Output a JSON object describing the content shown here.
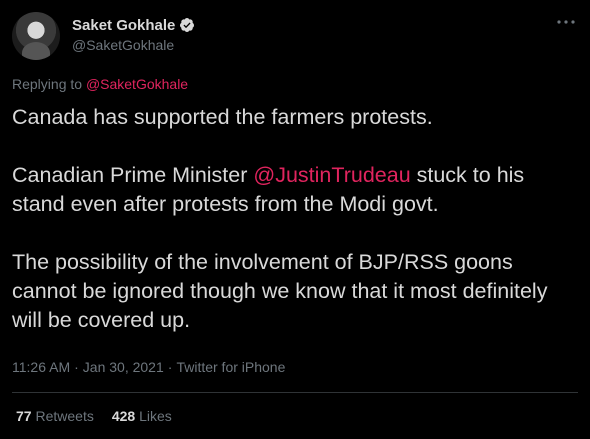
{
  "author": {
    "display_name": "Saket Gokhale",
    "handle": "@SaketGokhale",
    "verified_icon": "verified-badge-icon"
  },
  "reply_to": {
    "prefix": "Replying to ",
    "handle": "@SaketGokhale"
  },
  "tweet": {
    "para1": "Canada has supported the farmers protests.",
    "para2_before": "Canadian Prime Minister ",
    "para2_mention": "@JustinTrudeau",
    "para2_after": " stuck to his stand even after protests from the Modi govt.",
    "para3": "The possibility of the involvement of BJP/RSS goons cannot be ignored though we know that it most definitely will be covered up."
  },
  "meta": {
    "time": "11:26 AM",
    "date": "Jan 30, 2021",
    "source": "Twitter for iPhone",
    "separator": "·"
  },
  "stats": {
    "retweets_count": "77",
    "retweets_label": "Retweets",
    "likes_count": "428",
    "likes_label": "Likes"
  },
  "colors": {
    "background": "#000000",
    "text": "#d9d9d9",
    "muted": "#6e767d",
    "accent": "#e0245e",
    "divider": "#2f3336"
  }
}
